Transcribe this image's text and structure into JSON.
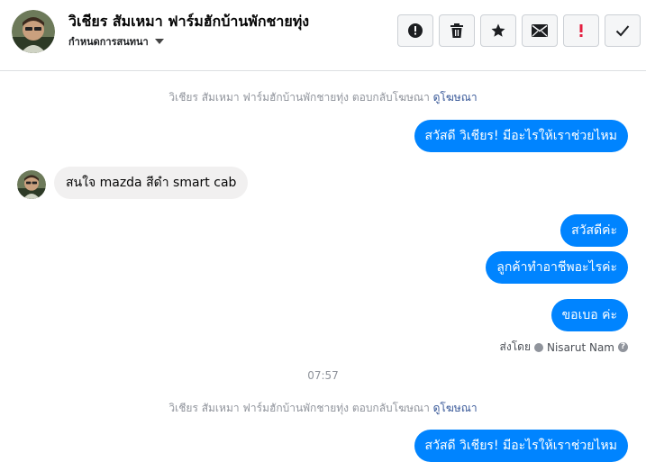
{
  "header": {
    "contact_name": "วิเชียร สัมเหมา ฟาร์มฮักบ้านพักชายทุ่ง",
    "assign_label": "กำหนดการสนทนา",
    "actions": [
      "mark-spam",
      "delete",
      "star",
      "mark-unread",
      "important",
      "done"
    ]
  },
  "thread": {
    "ad_reply_1": {
      "text": "วิเชียร สัมเหมา ฟาร์มฮักบ้านพักชายทุ่ง ตอบกลับโฆษณา",
      "link": "ดูโฆษณา"
    },
    "msg_out_1": "สวัสดี วิเชียร! มีอะไรให้เราช่วยไหม",
    "msg_in_1": "สนใจ mazda สีดำ smart cab",
    "msg_out_2": "สวัสดีค่ะ",
    "msg_out_3": "ลูกค้าทำอาชีพอะไรค่ะ",
    "msg_out_4": "ขอเบอ ค่ะ",
    "sent_by_label": "ส่งโดย",
    "sent_by_name": "Nisarut Nam",
    "timestamp": "07:57",
    "ad_reply_2": {
      "text": "วิเชียร สัมเหมา ฟาร์มฮักบ้านพักชายทุ่ง ตอบกลับโฆษณา",
      "link": "ดูโฆษณา"
    },
    "msg_out_5": "สวัสดี วิเชียร! มีอะไรให้เราช่วยไหม"
  },
  "colors": {
    "messenger_blue": "#0084ff",
    "incoming_bubble": "#f1f0f0",
    "link": "#385898",
    "important_red": "#e41e3f"
  }
}
